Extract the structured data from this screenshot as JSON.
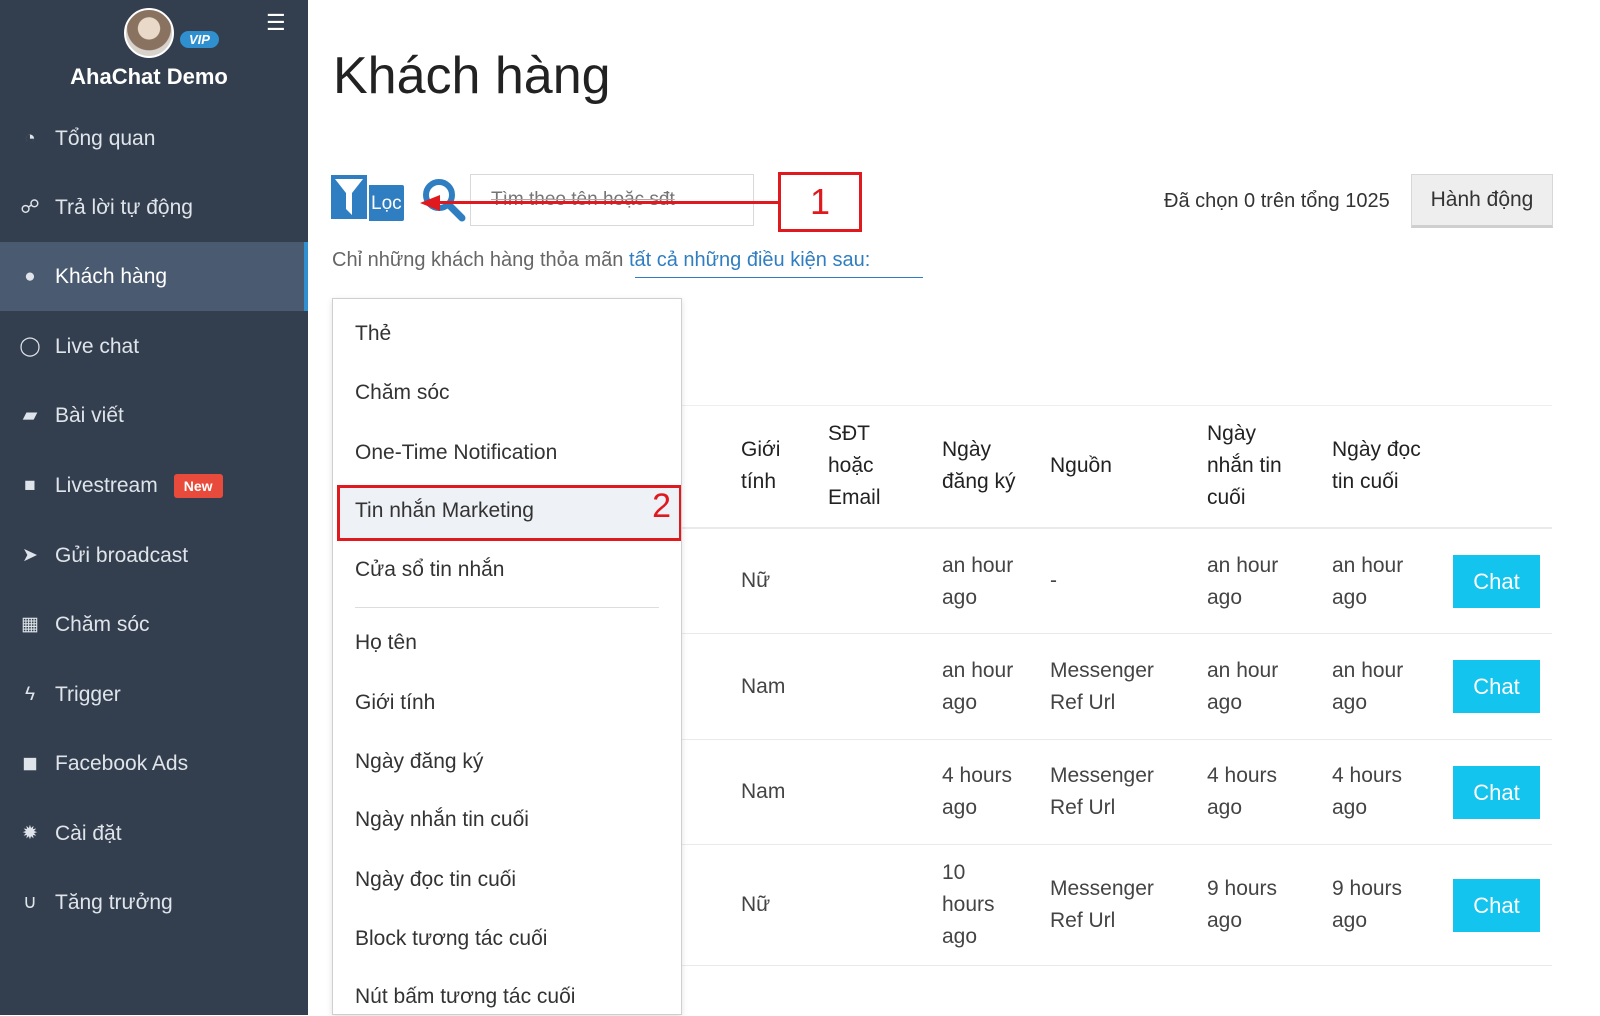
{
  "sidebar": {
    "vip": "VIP",
    "app_name": "AhaChat Demo",
    "items": [
      {
        "label": "Tổng quan",
        "icon": "dashboard-icon"
      },
      {
        "label": "Trả lời tự động",
        "icon": "sitemap-icon"
      },
      {
        "label": "Khách hàng",
        "icon": "user-icon"
      },
      {
        "label": "Live chat",
        "icon": "chat-bubble-icon"
      },
      {
        "label": "Bài viết",
        "icon": "book-icon"
      },
      {
        "label": "Livestream",
        "icon": "video-camera-icon",
        "badge": "New"
      },
      {
        "label": "Gửi broadcast",
        "icon": "paper-plane-icon"
      },
      {
        "label": "Chăm sóc",
        "icon": "calendar-icon"
      },
      {
        "label": "Trigger",
        "icon": "bolt-icon"
      },
      {
        "label": "Facebook Ads",
        "icon": "facebook-icon"
      },
      {
        "label": "Cài đặt",
        "icon": "gear-icon"
      },
      {
        "label": "Tăng trưởng",
        "icon": "magnet-icon"
      }
    ]
  },
  "main": {
    "title": "Khách hàng",
    "filter_label": "Lọc",
    "search_placeholder": "Tìm theo tên hoặc sđt",
    "annotation_1": "1",
    "annotation_2": "2",
    "selected_count": "Đã chọn 0 trên tổng 1025",
    "action_button": "Hành động",
    "condition_prefix": "Chỉ những khách hàng thỏa mãn ",
    "condition_link": "tất cả những điều kiện sau:"
  },
  "dropdown": {
    "items": [
      "Thẻ",
      "Chăm sóc",
      "One-Time Notification",
      "Tin nhắn Marketing",
      "Cửa sổ tin nhắn",
      "Họ tên",
      "Giới tính",
      "Ngày đăng ký",
      "Ngày nhắn tin cuối",
      "Ngày đọc tin cuối",
      "Block tương tác cuối",
      "Nút bấm tương tác cuối"
    ]
  },
  "table": {
    "headers": {
      "gender_1": "Giới",
      "gender_2": "tính",
      "contact_1": "SĐT",
      "contact_2": "hoặc",
      "contact_3": "Email",
      "reg_1": "Ngày",
      "reg_2": "đăng ký",
      "source": "Nguồn",
      "lastmsg_1": "Ngày",
      "lastmsg_2": "nhắn tin",
      "lastmsg_3": "cuối",
      "lastread_1": "Ngày đọc",
      "lastread_2": "tin cuối"
    },
    "rows": [
      {
        "gender": "Nữ",
        "reg_1": "an hour",
        "reg_2": "ago",
        "reg_3": "",
        "source_1": "-",
        "source_2": "",
        "msg_1": "an hour",
        "msg_2": "ago",
        "read_1": "an hour",
        "read_2": "ago",
        "chat": "Chat"
      },
      {
        "gender": "Nam",
        "reg_1": "an hour",
        "reg_2": "ago",
        "reg_3": "",
        "source_1": "Messenger",
        "source_2": "Ref Url",
        "msg_1": "an hour",
        "msg_2": "ago",
        "read_1": "an hour",
        "read_2": "ago",
        "chat": "Chat"
      },
      {
        "gender": "Nam",
        "reg_1": "4 hours",
        "reg_2": "ago",
        "reg_3": "",
        "source_1": "Messenger",
        "source_2": "Ref Url",
        "msg_1": "4 hours",
        "msg_2": "ago",
        "read_1": "4 hours",
        "read_2": "ago",
        "chat": "Chat"
      },
      {
        "gender": "Nữ",
        "reg_1": "10",
        "reg_2": "hours",
        "reg_3": "ago",
        "source_1": "Messenger",
        "source_2": "Ref Url",
        "msg_1": "9 hours",
        "msg_2": "ago",
        "read_1": "9 hours",
        "read_2": "ago",
        "chat": "Chat"
      }
    ]
  },
  "colors": {
    "sidebar": "#333f4f",
    "accent": "#2f7ec1",
    "chat_button": "#13c4ee",
    "annotation": "#e0191e"
  }
}
